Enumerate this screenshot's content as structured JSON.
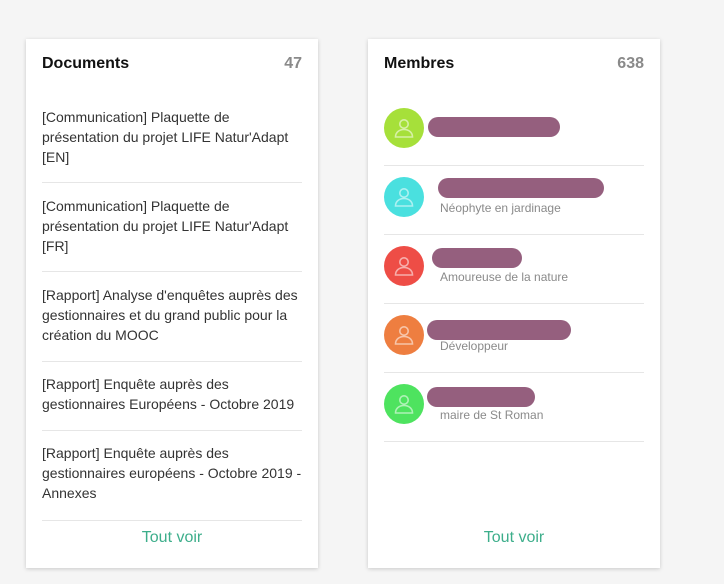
{
  "documents": {
    "title": "Documents",
    "count": "47",
    "see_all": "Tout voir",
    "items": [
      {
        "lines": [
          "[Communication] Plaquette de",
          "présentation du projet LIFE Natur'Adapt",
          "[EN]"
        ]
      },
      {
        "lines": [
          "[Communication] Plaquette de",
          "présentation du projet LIFE Natur'Adapt",
          "[FR]"
        ]
      },
      {
        "lines": [
          "[Rapport] Analyse d'enquêtes auprès des",
          "gestionnaires et du grand public pour la",
          "création du MOOC"
        ]
      },
      {
        "lines": [
          "[Rapport] Enquête auprès des",
          "gestionnaires Européens - Octobre 2019"
        ]
      },
      {
        "lines": [
          "[Rapport] Enquête auprès des",
          "gestionnaires européens - Octobre 2019 -",
          "Annexes"
        ]
      }
    ]
  },
  "members": {
    "title": "Membres",
    "count": "638",
    "see_all": "Tout voir",
    "items": [
      {
        "role": "",
        "avatar_color": "#a6e03a"
      },
      {
        "role": "Néophyte en jardinage",
        "avatar_color": "#4ae0df"
      },
      {
        "role": "Amoureuse de la nature",
        "avatar_color": "#ee4d46"
      },
      {
        "role": "Développeur",
        "avatar_color": "#ee7e40"
      },
      {
        "role": "maire de St Roman",
        "avatar_color": "#4ee35f"
      }
    ]
  },
  "colors": {
    "link": "#3dae8b",
    "redaction": "#955f7e"
  }
}
